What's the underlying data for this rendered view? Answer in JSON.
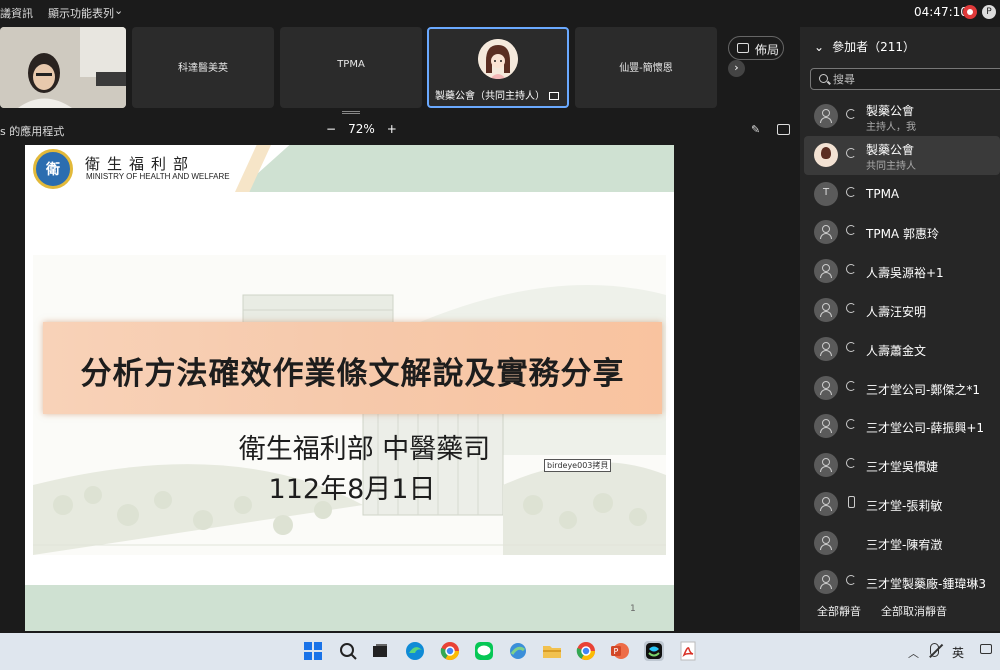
{
  "topbar": {
    "menu_a": "議資訊",
    "menu_b": "顯示功能表列",
    "clock": "04:47:10"
  },
  "tiles": [
    {
      "name": ""
    },
    {
      "name": "科達醫美英"
    },
    {
      "name": "TPMA"
    },
    {
      "name": "製藥公會（共同主持人）"
    },
    {
      "name": "仙豐-簡懷恩"
    }
  ],
  "layout_button": "佈局",
  "sharebar": {
    "title": "s 的應用程式",
    "zoom_minus": "−",
    "zoom_value": "72%",
    "zoom_plus": "+"
  },
  "slide": {
    "org_zh": "衛生福利部",
    "org_en": "MINISTRY OF HEALTH AND WELFARE",
    "title": "分析方法確效作業條文解說及實務分享",
    "subtitle": "衛生福利部 中醫藥司",
    "date": "112年8月1日",
    "watermark_tag": "birdeye003拷貝",
    "page_number": "1"
  },
  "panel": {
    "header": "參加者（211）",
    "search_placeholder": "搜尋",
    "participants": [
      {
        "name": "製藥公會",
        "role": "主持人，我",
        "avatar": "person-icon",
        "audio": "headset"
      },
      {
        "name": "製藥公會",
        "role": "共同主持人",
        "avatar": "photo",
        "audio": "headset"
      },
      {
        "name": "TPMA",
        "role": "",
        "avatar": "T",
        "audio": "headset"
      },
      {
        "name": "TPMA 郭惠玲",
        "role": "",
        "avatar": "person-icon",
        "audio": "headset"
      },
      {
        "name": "人壽吳源裕+1",
        "role": "",
        "avatar": "person-icon",
        "audio": "headset"
      },
      {
        "name": "人壽汪安明",
        "role": "",
        "avatar": "person-icon",
        "audio": "headset"
      },
      {
        "name": "人壽蕭金文",
        "role": "",
        "avatar": "person-icon",
        "audio": "headset"
      },
      {
        "name": "三才堂公司-鄭傑之*1",
        "role": "",
        "avatar": "person-icon",
        "audio": "headset"
      },
      {
        "name": "三才堂公司-薛振興+1",
        "role": "",
        "avatar": "person-icon",
        "audio": "headset"
      },
      {
        "name": "三才堂吳慣婕",
        "role": "",
        "avatar": "person-icon",
        "audio": "headset"
      },
      {
        "name": "三才堂-張莉敏",
        "role": "",
        "avatar": "person-icon",
        "audio": "phone"
      },
      {
        "name": "三才堂-陳宥澂",
        "role": "",
        "avatar": "person-icon",
        "audio": "none"
      },
      {
        "name": "三才堂製藥廠-鍾瑋琳3",
        "role": "",
        "avatar": "person-icon",
        "audio": "headset"
      }
    ],
    "mute_all": "全部靜音",
    "unmute_all": "全部取消靜音"
  },
  "taskbar": {
    "lang": "英",
    "apps": [
      "windows-start-icon",
      "search-icon",
      "task-view-icon",
      "edge-icon",
      "chrome-icon",
      "line-icon",
      "vpn-icon",
      "file-explorer-icon",
      "chrome-icon",
      "powerpoint-icon",
      "webex-icon",
      "acrobat-icon"
    ],
    "colors": {
      "windows": "#1a73e8",
      "edge": "#0f8bd6",
      "chrome": "#e94235",
      "line": "#06c755",
      "explorer": "#f2c14e",
      "powerpoint": "#d24726",
      "webex": "#111111",
      "acrobat": "#d93025"
    }
  }
}
